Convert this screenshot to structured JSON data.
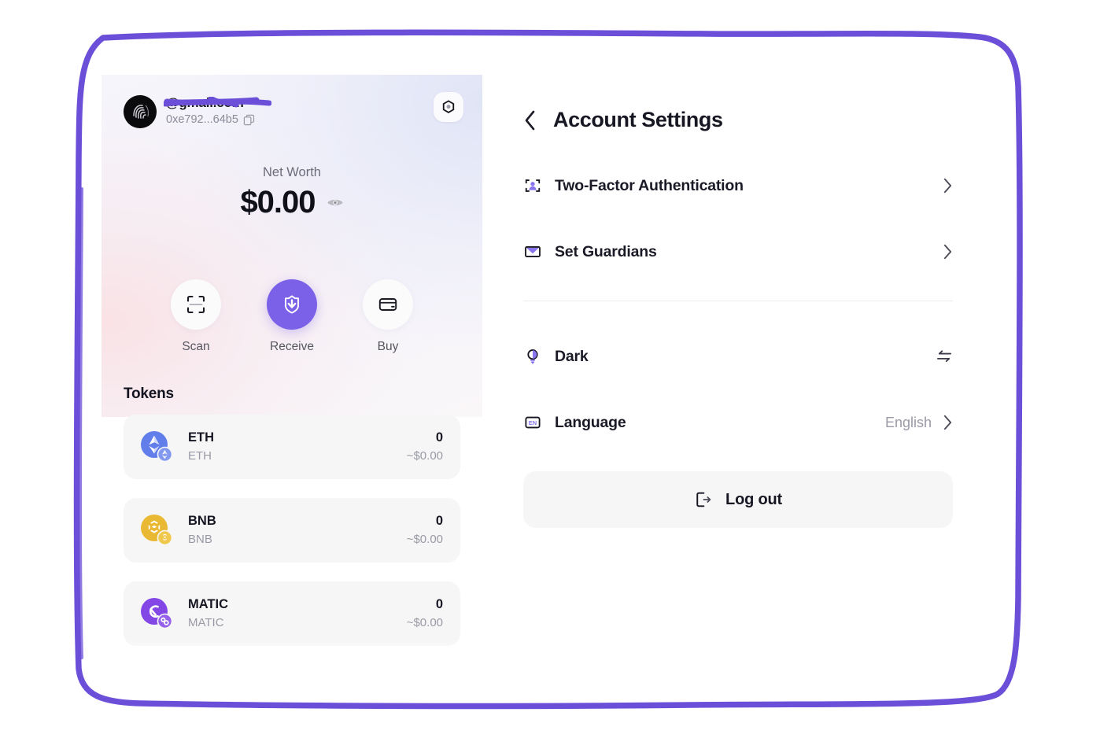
{
  "theme": {
    "accent": "#7b61e8",
    "accent_soft": "#8a75ef",
    "text_primary": "#171723",
    "text_muted": "#9a9aa6",
    "panel_bg": "#f6f6f7",
    "annotation_border": "#6b4fd8"
  },
  "wallet": {
    "account": {
      "email": "@gmail.com",
      "email_redacted": true,
      "address": "0xe792...64b5",
      "copy_icon": "copy-icon",
      "avatar_icon": "fingerprint-avatar",
      "settings_icon": "hex-nut-settings-icon"
    },
    "net_worth": {
      "label": "Net Worth",
      "value": "$0.00",
      "visibility_icon": "eye-icon"
    },
    "actions": [
      {
        "label": "Scan",
        "icon": "scan-frame-icon",
        "primary": false
      },
      {
        "label": "Receive",
        "icon": "shield-download-icon",
        "primary": true
      },
      {
        "label": "Buy",
        "icon": "credit-card-icon",
        "primary": false
      }
    ],
    "tokens": {
      "title": "Tokens",
      "items": [
        {
          "symbol": "ETH",
          "network": "ETH",
          "balance": "0",
          "fiat": "~$0.00",
          "icon": "eth-token-icon",
          "color": "#627eea",
          "badge": "#8198ee"
        },
        {
          "symbol": "BNB",
          "network": "BNB",
          "balance": "0",
          "fiat": "~$0.00",
          "icon": "bnb-token-icon",
          "color": "#eab933",
          "badge": "#f0c84e"
        },
        {
          "symbol": "MATIC",
          "network": "MATIC",
          "balance": "0",
          "fiat": "~$0.00",
          "icon": "matic-token-icon",
          "color": "#8247e5",
          "badge": "#9561ea"
        }
      ]
    }
  },
  "settings": {
    "back_icon": "chevron-left-icon",
    "title": "Account Settings",
    "rows": [
      {
        "label": "Two-Factor Authentication",
        "icon": "two-factor-person-icon",
        "value": "",
        "trailing": "chevron-right-icon"
      },
      {
        "label": "Set Guardians",
        "icon": "envelope-guardians-icon",
        "value": "",
        "trailing": "chevron-right-icon"
      }
    ],
    "preferences": [
      {
        "label": "Dark",
        "icon": "lightbulb-theme-icon",
        "value": "",
        "trailing": "swap-arrows-icon"
      },
      {
        "label": "Language",
        "icon": "en-language-icon",
        "value": "English",
        "trailing": "chevron-right-icon"
      }
    ],
    "logout": {
      "label": "Log out",
      "icon": "logout-exit-icon"
    }
  }
}
